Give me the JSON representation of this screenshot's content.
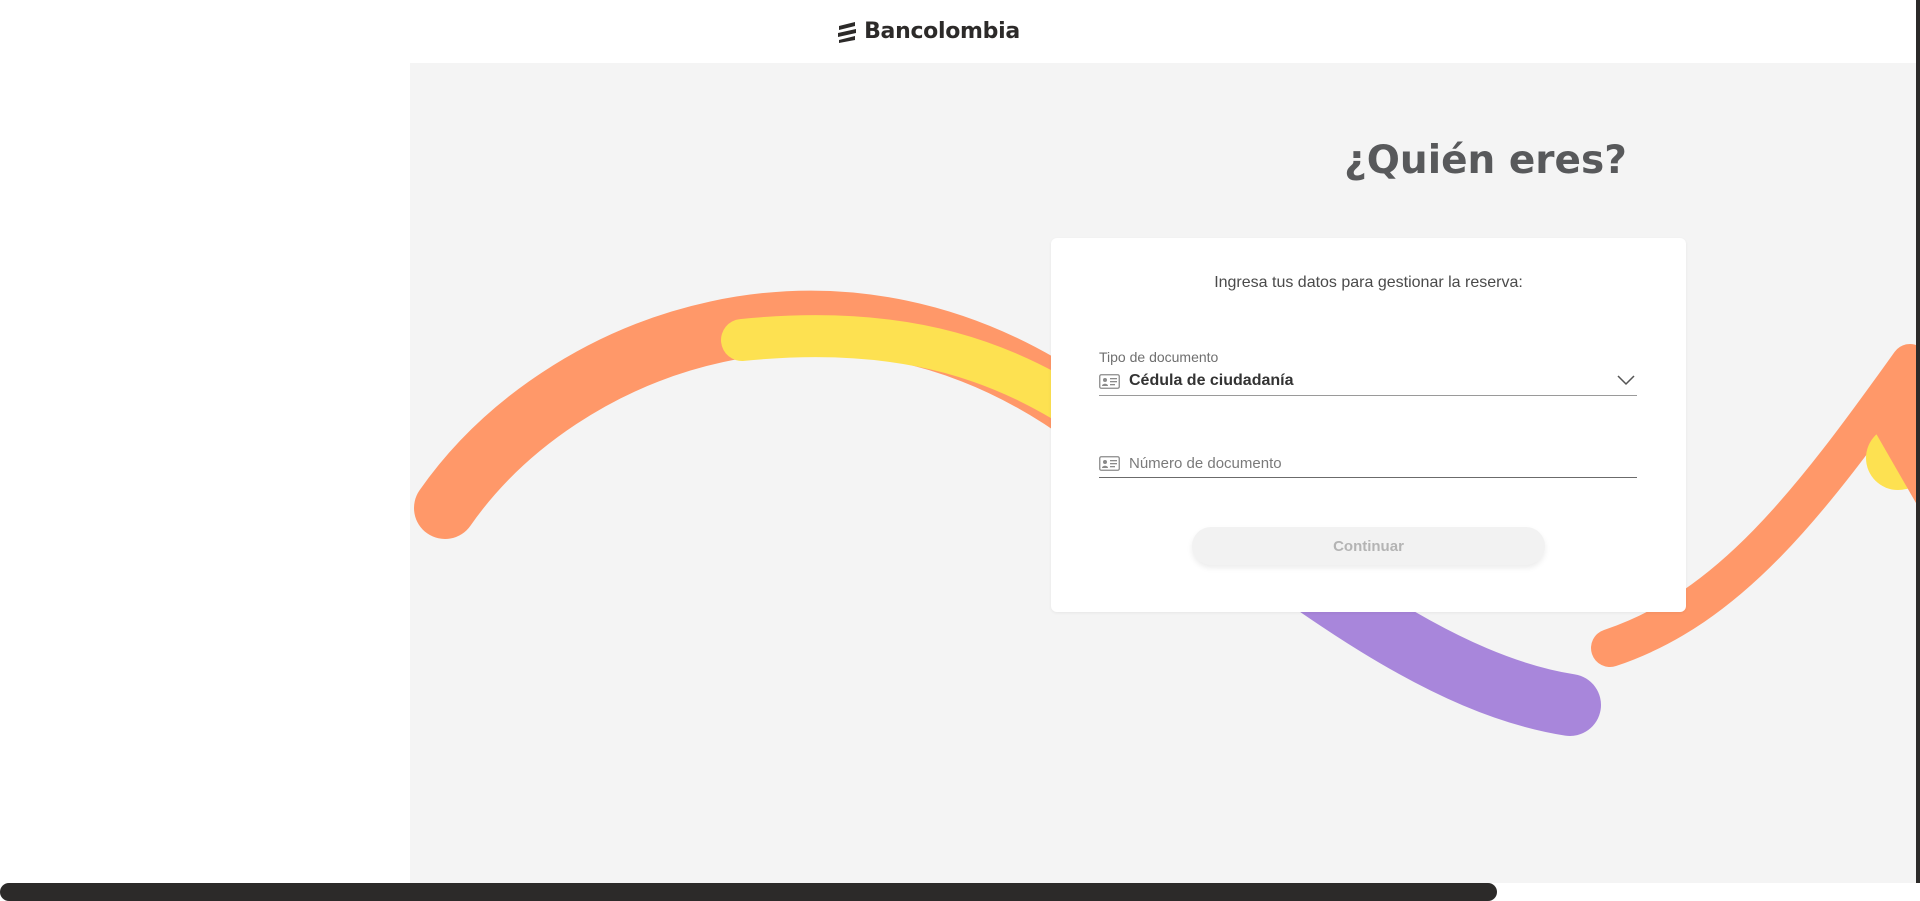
{
  "header": {
    "brand_name": "Bancolombia",
    "logo_icon": "bancolombia-stripes-icon"
  },
  "main": {
    "title": "¿Quién eres?",
    "card": {
      "subtitle": "Ingresa tus datos para gestionar la reserva:",
      "document_type": {
        "label": "Tipo de documento",
        "selected_value": "Cédula de ciudadanía",
        "icon": "id-card-icon",
        "dropdown_icon": "chevron-down-icon"
      },
      "document_number": {
        "placeholder": "Número de documento",
        "value": "",
        "icon": "id-card-icon"
      },
      "continue_label": "Continuar"
    }
  },
  "colors": {
    "background": "#f4f4f4",
    "orange": "#ff9869",
    "yellow": "#fde151",
    "purple": "#a886db",
    "title_text": "#58595b",
    "brand_dark": "#2c2a29"
  }
}
